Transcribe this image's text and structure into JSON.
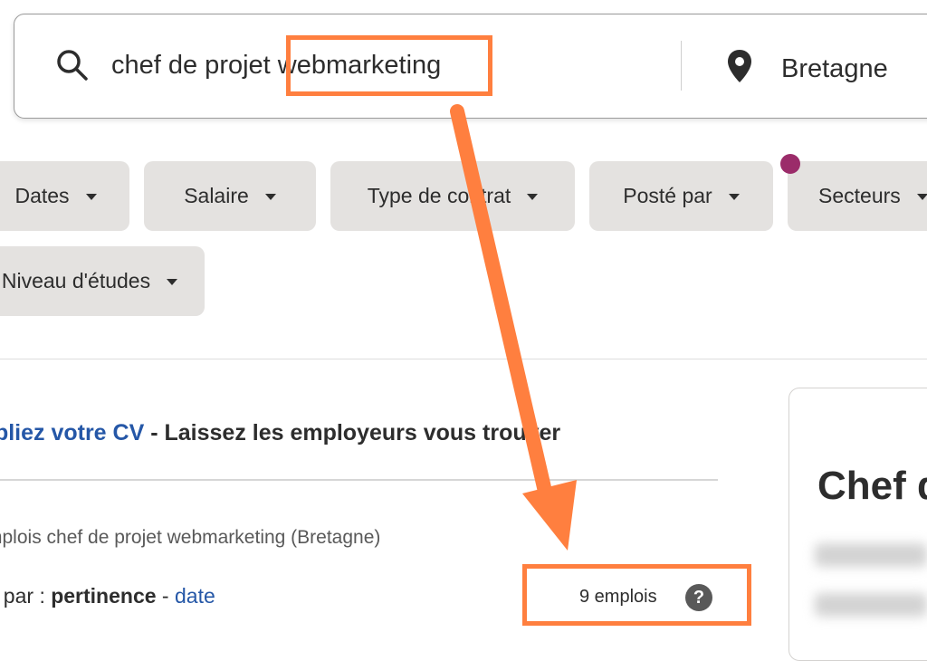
{
  "search": {
    "query": "chef de projet webmarketing",
    "location": "Bretagne"
  },
  "filters": [
    {
      "label": "Dates"
    },
    {
      "label": "Salaire"
    },
    {
      "label": "Type de contrat"
    },
    {
      "label": "Posté par"
    },
    {
      "label": "Secteurs"
    },
    {
      "label": "Niveau d'études"
    }
  ],
  "cv_banner": {
    "link": "Publiez votre CV",
    "rest": " - Laissez les employeurs vous trouver"
  },
  "results": {
    "meta": "Emplois chef de projet webmarketing (Bretagne)",
    "sort_prefix": "Trier par : ",
    "sort_active": "pertinence",
    "sort_sep": " - ",
    "sort_alt": "date",
    "count": "9 emplois",
    "help": "?"
  },
  "job_card": {
    "title": "Chef d"
  },
  "colors": {
    "accent_link": "#2557a7",
    "annotation": "#ff7f3f",
    "indicator_dot": "#9b2c6a",
    "chip_bg": "#e4e2e0"
  }
}
